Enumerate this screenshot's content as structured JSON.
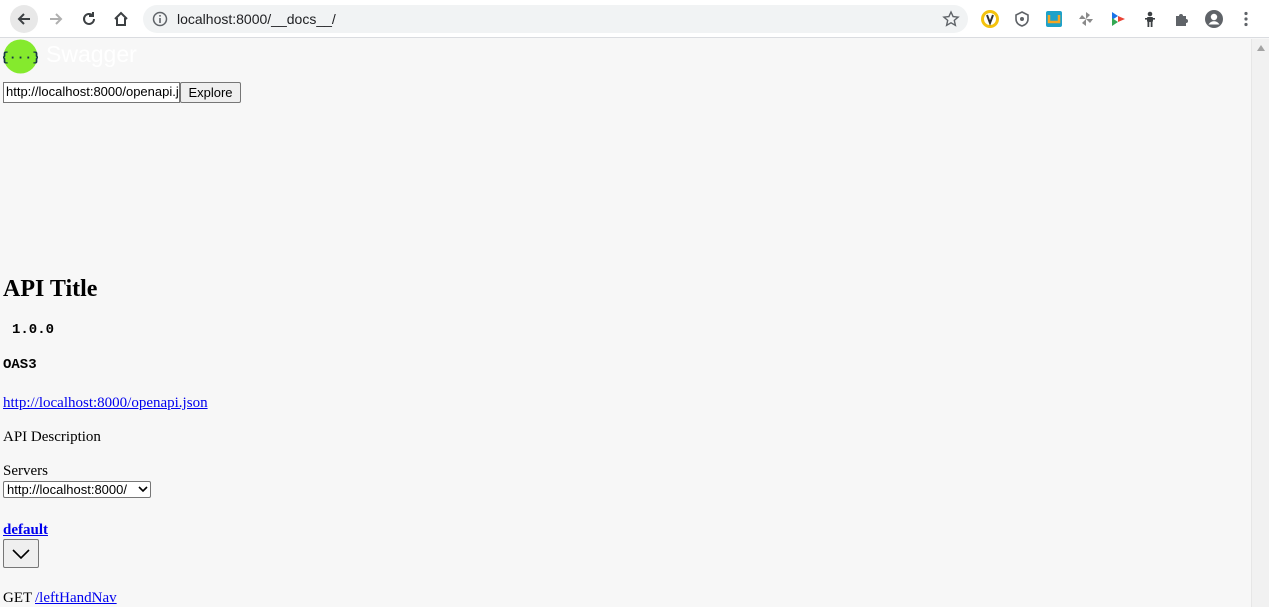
{
  "browser": {
    "url": "localhost:8000/__docs__/",
    "icons": [
      "back-icon",
      "forward-icon",
      "reload-icon",
      "home-icon",
      "info-icon",
      "star-icon",
      "extension-icon",
      "puzzle-icon",
      "profile-icon",
      "menu-icon"
    ]
  },
  "page": {
    "logo_text": "Swagger",
    "spec_url_value": "http://localhost:8000/openapi.json",
    "explore_label": "Explore",
    "title": "API Title",
    "version": "1.0.0",
    "oas": "OAS3",
    "spec_link": "http://localhost:8000/openapi.json",
    "description": "API Description",
    "servers_label": "Servers",
    "server_selected": "http://localhost:8000/",
    "tag_name": "default",
    "operation_method": "GET",
    "operation_path": "/leftHandNav"
  }
}
